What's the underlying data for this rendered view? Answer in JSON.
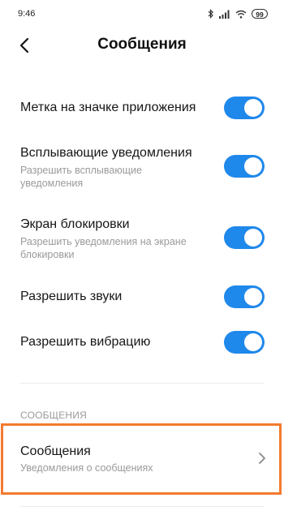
{
  "status_bar": {
    "time": "9:46",
    "icons": [
      "bluetooth-icon",
      "signal-icon",
      "wifi-icon"
    ],
    "battery": "99"
  },
  "header": {
    "title": "Сообщения",
    "back_icon": "back-arrow-icon"
  },
  "settings": [
    {
      "label": "Метка на значке приложения",
      "sub": "",
      "enabled": true
    },
    {
      "label": "Всплывающие уведомления",
      "sub": "Разрешить всплывающие уведомления",
      "enabled": true
    },
    {
      "label": "Экран блокировки",
      "sub": "Разрешить уведомления на экране блокировки",
      "enabled": true
    },
    {
      "label": "Разрешить звуки",
      "sub": "",
      "enabled": true
    },
    {
      "label": "Разрешить вибрацию",
      "sub": "",
      "enabled": true
    }
  ],
  "section": {
    "header": "СООБЩЕНИЯ",
    "item": {
      "label": "Сообщения",
      "sub": "Уведомления о сообщениях"
    }
  },
  "colors": {
    "toggle_on": "#1f88eb",
    "highlight": "#f47a2e"
  }
}
